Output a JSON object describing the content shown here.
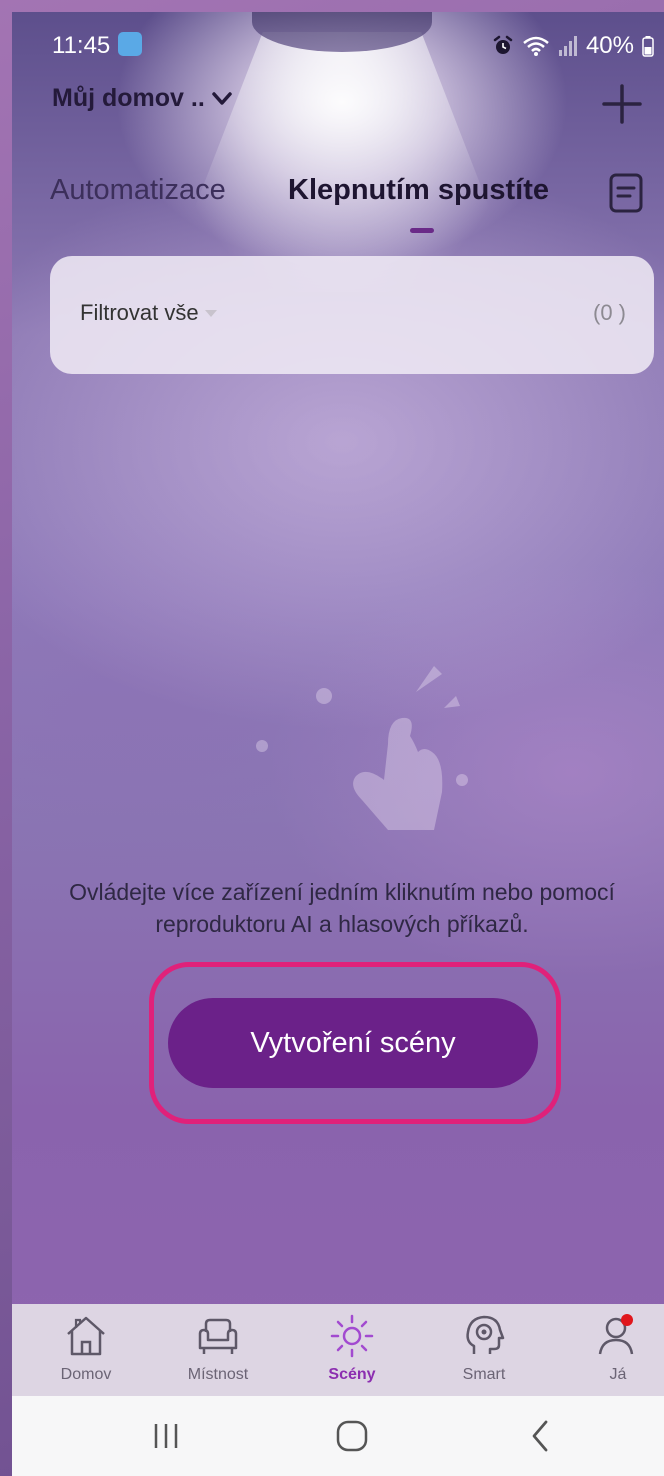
{
  "status_bar": {
    "time": "11:45",
    "battery": "40%"
  },
  "header": {
    "home_name": "Můj domov ..",
    "add_icon": "plus-icon"
  },
  "tabs": [
    {
      "label": "Automatizace",
      "active": false
    },
    {
      "label": "Klepnutím spustíte",
      "active": true
    }
  ],
  "filter": {
    "label": "Filtrovat vše",
    "count": "(0 )"
  },
  "empty_state": {
    "illustration": "tap-hand-icon",
    "message": "Ovládejte více zařízení jedním kliknutím nebo pomocí reproduktoru AI a hlasových příkazů.",
    "create_button": "Vytvoření scény"
  },
  "bottom_nav": [
    {
      "label": "Domov",
      "icon": "house-icon",
      "active": false
    },
    {
      "label": "Místnost",
      "icon": "armchair-icon",
      "active": false
    },
    {
      "label": "Scény",
      "icon": "sun-icon",
      "active": true
    },
    {
      "label": "Smart",
      "icon": "head-gear-icon",
      "active": false
    },
    {
      "label": "Já",
      "icon": "profile-icon",
      "active": false
    }
  ],
  "colors": {
    "accent": "#6b2189",
    "highlight": "#e0217a",
    "active_nav": "#8c2eb0",
    "notification_dot": "#e0161c"
  }
}
